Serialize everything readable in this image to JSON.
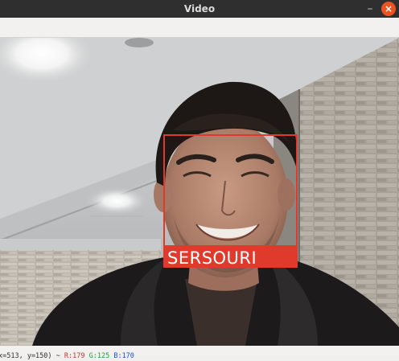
{
  "window": {
    "title": "Video",
    "minimize_glyph": "–",
    "close_glyph": "×"
  },
  "detection": {
    "label": "SERSOURI",
    "box_color": "#e03a2c"
  },
  "status": {
    "coords": "x=513, y=150) ~ ",
    "r": "R:179",
    "g": "G:125",
    "b": "B:170"
  },
  "icons": {
    "minimize": "minimize-icon",
    "close": "close-icon"
  }
}
